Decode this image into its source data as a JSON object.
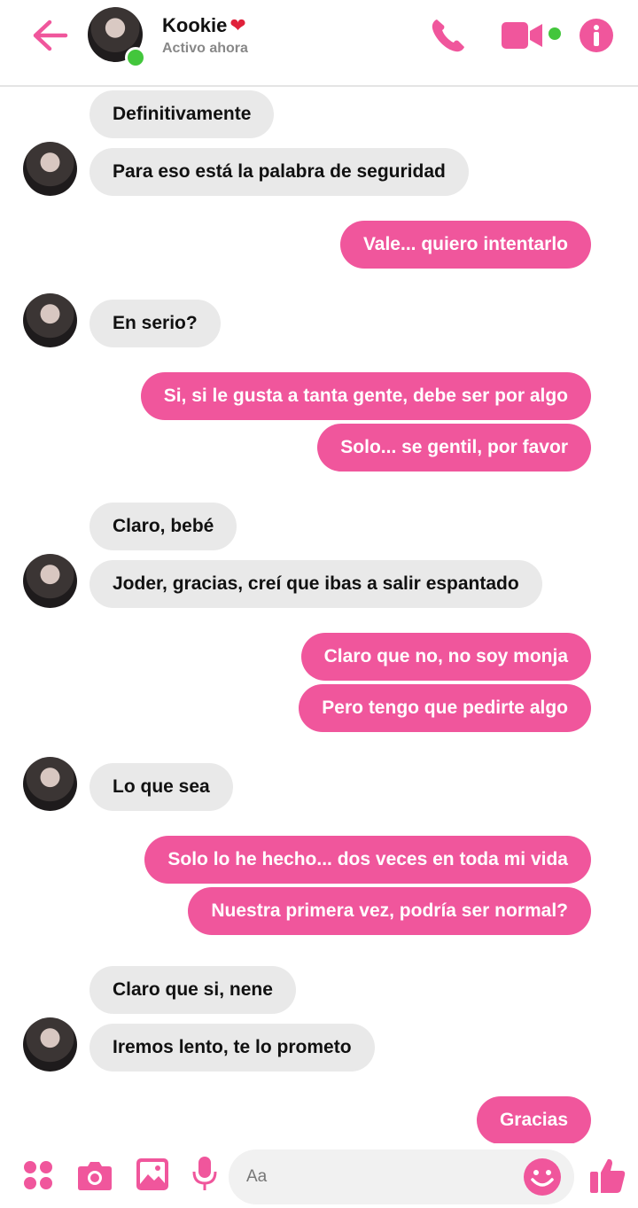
{
  "header": {
    "contact_name": "Kookie",
    "heart": "❤",
    "status": "Activo ahora",
    "icons": [
      "back-arrow-icon",
      "phone-icon",
      "video-call-icon",
      "info-icon"
    ]
  },
  "messages": [
    {
      "side": "in",
      "text": "Definitivamente"
    },
    {
      "side": "in",
      "text": "Para eso está la palabra de seguridad"
    },
    {
      "side": "out",
      "text": "Vale... quiero intentarlo"
    },
    {
      "side": "in",
      "text": "En serio?"
    },
    {
      "side": "out",
      "text": "Si, si le gusta a tanta gente, debe ser por algo"
    },
    {
      "side": "out",
      "text": "Solo... se gentil, por favor"
    },
    {
      "side": "in",
      "text": "Claro, bebé"
    },
    {
      "side": "in",
      "text": "Joder, gracias, creí que ibas a salir espantado"
    },
    {
      "side": "out",
      "text": "Claro que no, no soy monja"
    },
    {
      "side": "out",
      "text": "Pero tengo que pedirte algo"
    },
    {
      "side": "in",
      "text": "Lo que sea"
    },
    {
      "side": "out",
      "text": "Solo lo he hecho... dos veces en toda mi vida"
    },
    {
      "side": "out",
      "text": "Nuestra primera vez, podría ser normal?"
    },
    {
      "side": "in",
      "text": "Claro que si, nene"
    },
    {
      "side": "in",
      "text": "Iremos lento, te lo prometo"
    },
    {
      "side": "out",
      "text": "Gracias"
    }
  ],
  "composer": {
    "placeholder": "Aa",
    "icons": [
      "apps-grid-icon",
      "camera-icon",
      "gallery-icon",
      "microphone-icon",
      "emoji-icon",
      "thumbs-up-icon"
    ]
  },
  "colors": {
    "accent": "#f0569c",
    "incoming_bubble": "#e9e9e9",
    "online": "#43c63c"
  }
}
